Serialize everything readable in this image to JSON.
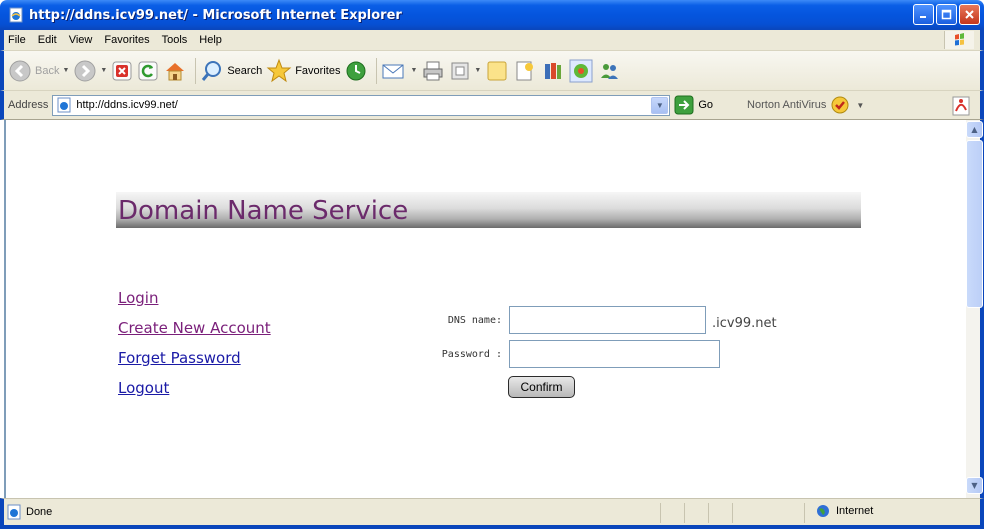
{
  "window": {
    "title": "http://ddns.icv99.net/ - Microsoft Internet Explorer"
  },
  "menu": {
    "items": [
      "File",
      "Edit",
      "View",
      "Favorites",
      "Tools",
      "Help"
    ]
  },
  "toolbar": {
    "back_label": "Back",
    "search_label": "Search",
    "favorites_label": "Favorites"
  },
  "address": {
    "label": "Address",
    "url": "http://ddns.icv99.net/",
    "go_label": "Go",
    "norton_label": "Norton AntiVirus"
  },
  "page": {
    "banner_title": "Domain Name Service",
    "links": [
      {
        "label": "Login",
        "visited": true
      },
      {
        "label": "Create New Account",
        "visited": true
      },
      {
        "label": "Forget Password",
        "visited": false
      },
      {
        "label": "Logout",
        "visited": false
      }
    ],
    "form": {
      "dns_label": "DNS name:",
      "dns_value": "",
      "domain_suffix": ".icv99.net",
      "password_label": "Password :",
      "password_value": "",
      "confirm_label": "Confirm"
    }
  },
  "status": {
    "text": "Done",
    "zone": "Internet"
  },
  "colors": {
    "title_bar": "#0555de",
    "chrome": "#ece9d8",
    "banner_text": "#6b2a6b",
    "visited_link": "#7a1f7a",
    "link": "#1a1aa6"
  }
}
